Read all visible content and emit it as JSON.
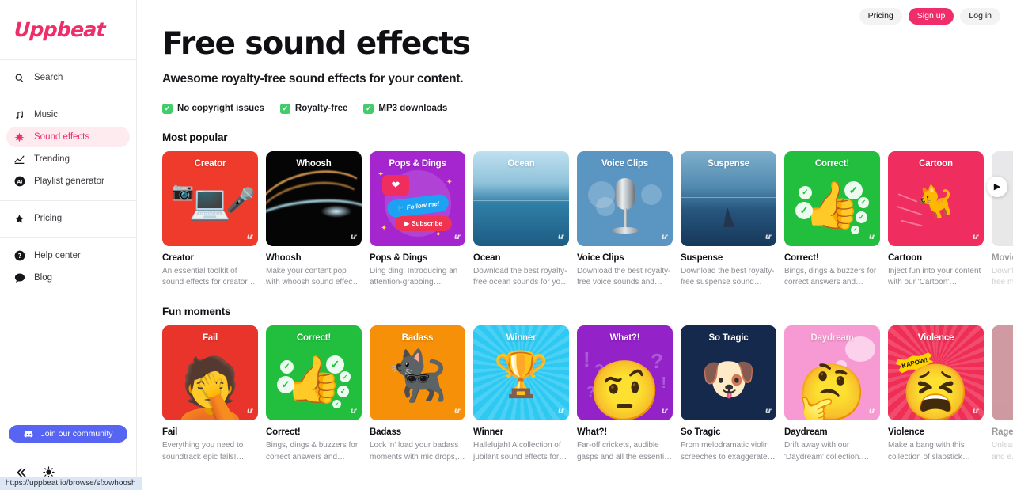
{
  "brand": {
    "name": "Uppbeat",
    "accent": "#ef2d6b",
    "active_bg": "#fdebf0"
  },
  "sidebar": {
    "search": {
      "label": "Search",
      "icon": "search-icon"
    },
    "groups": [
      {
        "items": [
          {
            "label": "Music",
            "icon": "music-note-icon",
            "active": false
          },
          {
            "label": "Sound effects",
            "icon": "sparkle-icon",
            "active": true
          },
          {
            "label": "Trending",
            "icon": "trending-chart-icon",
            "active": false
          },
          {
            "label": "Playlist generator",
            "icon": "ai-circle-icon",
            "active": false
          }
        ]
      },
      {
        "items": [
          {
            "label": "Pricing",
            "icon": "star-icon",
            "active": false
          }
        ]
      },
      {
        "items": [
          {
            "label": "Help center",
            "icon": "question-circle-icon",
            "active": false
          },
          {
            "label": "Blog",
            "icon": "speech-bubble-icon",
            "active": false
          }
        ]
      }
    ],
    "community": {
      "label": "Join our community",
      "icon": "discord-icon",
      "color": "#5865f2"
    },
    "footer": [
      {
        "name": "collapse-sidebar-icon",
        "glyph": "«"
      },
      {
        "name": "theme-toggle-sun-icon",
        "glyph": "☀"
      }
    ]
  },
  "topbar": {
    "buttons": [
      {
        "label": "Pricing",
        "style": "plain"
      },
      {
        "label": "Sign up",
        "style": "primary"
      },
      {
        "label": "Log in",
        "style": "plain"
      }
    ]
  },
  "hero": {
    "title": "Free sound effects",
    "subtitle": "Awesome royalty-free sound effects for your content.",
    "badges": [
      {
        "label": "No copyright issues",
        "tick": "✓"
      },
      {
        "label": "Royalty-free",
        "tick": "✓"
      },
      {
        "label": "MP3 downloads",
        "tick": "✓"
      }
    ]
  },
  "sections": [
    {
      "title": "Most popular",
      "cards": [
        {
          "title": "Creator",
          "name": "Creator",
          "desc": "An essential toolkit of sound effects for creators. Bring you...",
          "art": "creator",
          "faded": false
        },
        {
          "title": "Whoosh",
          "name": "Whoosh",
          "desc": "Make your content pop with whoosh sound effects and...",
          "art": "whoosh",
          "faded": false
        },
        {
          "title": "Pops & Dings",
          "name": "Pops & Dings",
          "desc": "Ding ding! Introducing an attention-grabbing collection ...",
          "art": "pops",
          "faded": false
        },
        {
          "title": "Ocean",
          "name": "Ocean",
          "desc": "Download the best royalty-free ocean sounds for your conten...",
          "art": "ocean",
          "faded": false
        },
        {
          "title": "Voice Clips",
          "name": "Voice Clips",
          "desc": "Download the best royalty-free voice sounds and speach...",
          "art": "voice",
          "faded": false
        },
        {
          "title": "Suspense",
          "name": "Suspense",
          "desc": "Download the best royalty-free suspense sound effects for yo...",
          "art": "suspense",
          "faded": false
        },
        {
          "title": "Correct!",
          "name": "Correct!",
          "desc": "Bings, dings & buzzers for correct answers and eureka...",
          "art": "correct",
          "faded": false
        },
        {
          "title": "Cartoon",
          "name": "Cartoon",
          "desc": "Inject fun into your content with our 'Cartoon' collection. Fro...",
          "art": "cartoon",
          "faded": false
        },
        {
          "title": "Movie",
          "name": "Movie",
          "desc": "Download the best royalty-free movie sound effects...",
          "art": "movie",
          "faded": true
        }
      ],
      "next_label": "▶"
    },
    {
      "title": "Fun moments",
      "cards": [
        {
          "title": "Fail",
          "name": "Fail",
          "desc": "Everything you need to soundtrack epic fails! From...",
          "art": "fail",
          "faded": false
        },
        {
          "title": "Correct!",
          "name": "Correct!",
          "desc": "Bings, dings & buzzers for correct answers and eureka...",
          "art": "correct",
          "faded": false
        },
        {
          "title": "Badass",
          "name": "Badass",
          "desc": "Lock 'n' load your badass moments with mic drops, guit...",
          "art": "badass",
          "faded": false
        },
        {
          "title": "Winner",
          "name": "Winner",
          "desc": "Hallelujah! A collection of jubilant sound effects for whe...",
          "art": "winner",
          "faded": false
        },
        {
          "title": "What?!",
          "name": "What?!",
          "desc": "Far-off crickets, audible gasps and all the essential sound...",
          "art": "what",
          "faded": false
        },
        {
          "title": "So Tragic",
          "name": "So Tragic",
          "desc": "From melodramatic violin screeches to exaggerated sig...",
          "art": "tragic",
          "faded": false
        },
        {
          "title": "Daydream",
          "name": "Daydream",
          "desc": "Drift away with our 'Daydream' collection. From whimsical...",
          "art": "daydream",
          "faded": false
        },
        {
          "title": "Violence",
          "name": "Violence",
          "desc": "Make a bang with this collection of slapstick punche...",
          "art": "violence",
          "faded": false
        },
        {
          "title": "Rage",
          "name": "Rage",
          "desc": "Unleash your inner rage and e...",
          "art": "rage",
          "faded": true
        }
      ],
      "next_label": "▶"
    }
  ],
  "card_watermark": "ư",
  "statusbar": {
    "url": "https://uppbeat.io/browse/sfx/whoosh"
  }
}
